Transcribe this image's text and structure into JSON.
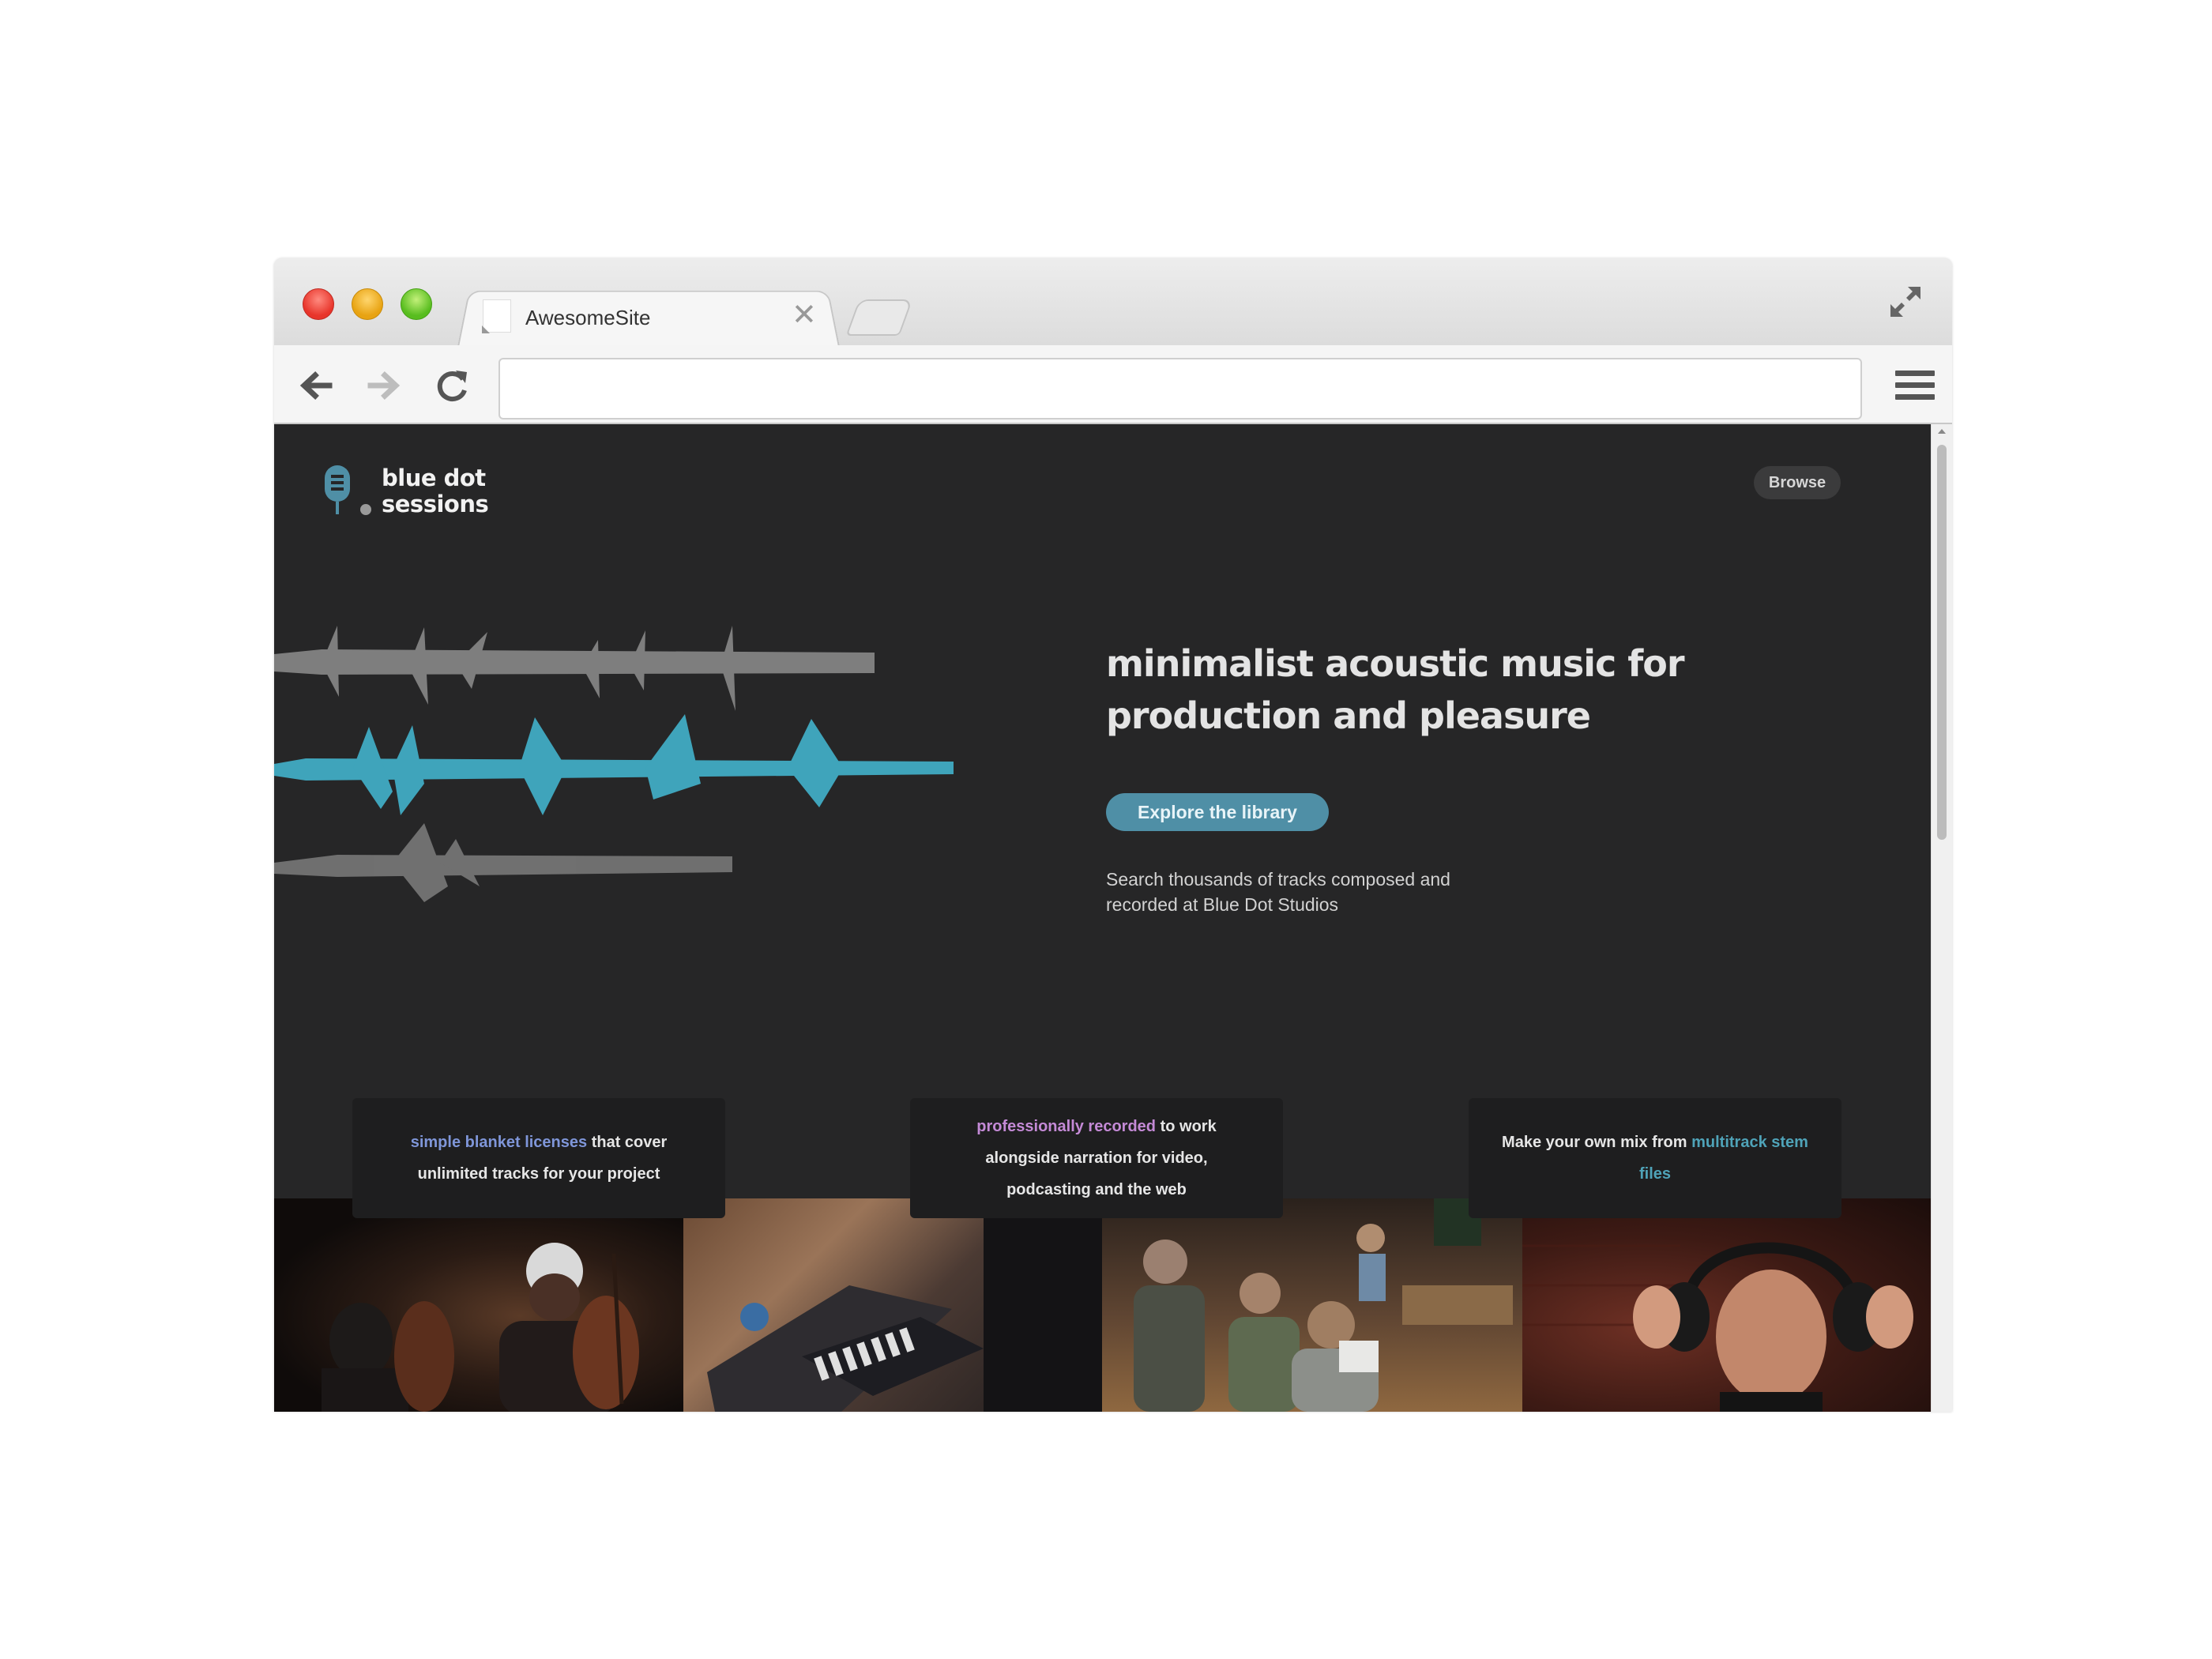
{
  "browser": {
    "tab_title": "AwesomeSite",
    "tab_close": "✕",
    "url": ""
  },
  "site": {
    "logo_line1": "blue dot",
    "logo_line2": "sessions",
    "nav_browse": "Browse",
    "headline_line1": "minimalist acoustic music for",
    "headline_line2": "production and pleasure",
    "cta_label": "Explore the library",
    "subtext_line1": "Search thousands of tracks composed and",
    "subtext_line2": "recorded at Blue Dot Studios",
    "features": [
      {
        "highlight": "simple blanket licenses",
        "text_after": " that cover unlimited tracks for your project"
      },
      {
        "highlight": "professionally recorded",
        "text_after": " to work alongside narration for video, podcasting and the web"
      },
      {
        "text_before": "Make your own mix from ",
        "highlight": "multitrack stem files"
      }
    ]
  },
  "colors": {
    "page_bg": "#262627",
    "accent_teal": "#4f8fa6",
    "highlight_blue": "#7f96d9",
    "highlight_purple": "#c48ad6",
    "highlight_teal": "#4fa3b8"
  },
  "icons": {
    "back": "arrow-left-icon",
    "forward": "arrow-right-icon",
    "reload": "reload-icon",
    "menu": "hamburger-menu-icon",
    "fullscreen": "expand-icon",
    "logo": "microphone-icon"
  }
}
